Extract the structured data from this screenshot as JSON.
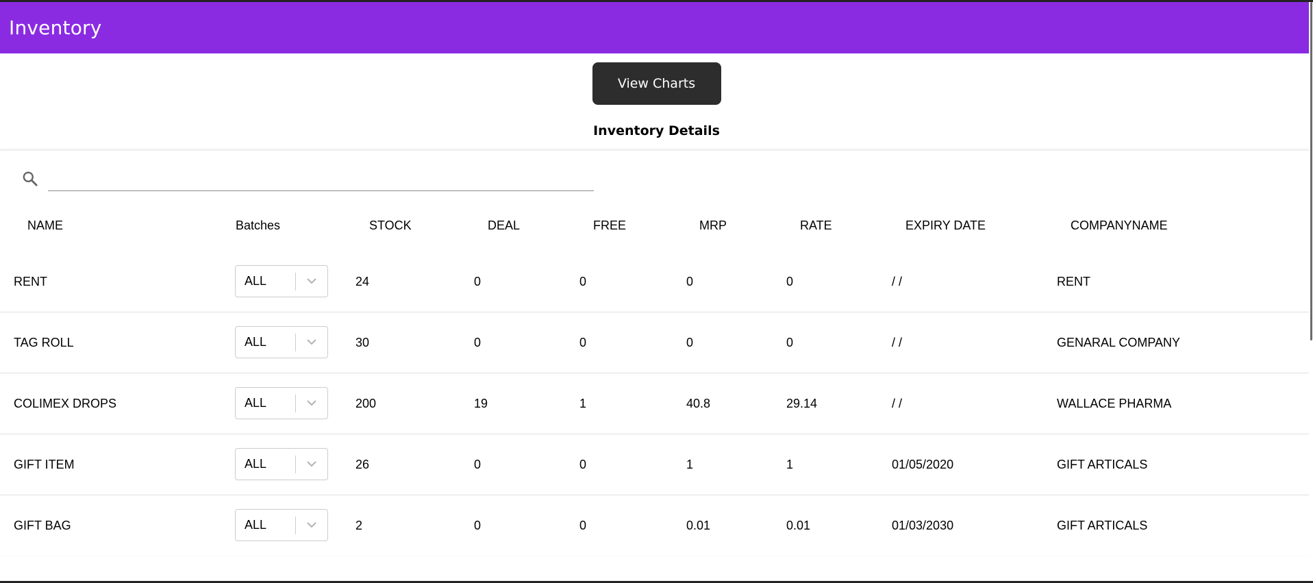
{
  "appbar": {
    "title": "Inventory"
  },
  "actions": {
    "view_charts_label": "View Charts"
  },
  "section": {
    "title": "Inventory Details"
  },
  "search": {
    "placeholder": "",
    "value": ""
  },
  "icons": {
    "search": "search-icon",
    "dropdown": "chevron-down-icon"
  },
  "colors": {
    "appbar": "#8a2be2",
    "button": "#2d2d2d"
  },
  "table": {
    "columns": [
      "NAME",
      "Batches",
      "STOCK",
      "DEAL",
      "FREE",
      "MRP",
      "RATE",
      "EXPIRY DATE",
      "COMPANYNAME"
    ],
    "rows": [
      {
        "name": "RENT",
        "batch": "ALL",
        "stock": "24",
        "deal": "0",
        "free": "0",
        "mrp": "0",
        "rate": "0",
        "expiry": "/ /",
        "company": "RENT"
      },
      {
        "name": "TAG ROLL",
        "batch": "ALL",
        "stock": "30",
        "deal": "0",
        "free": "0",
        "mrp": "0",
        "rate": "0",
        "expiry": "/ /",
        "company": "GENARAL COMPANY"
      },
      {
        "name": "COLIMEX DROPS",
        "batch": "ALL",
        "stock": "200",
        "deal": "19",
        "free": "1",
        "mrp": "40.8",
        "rate": "29.14",
        "expiry": "/ /",
        "company": "WALLACE PHARMA"
      },
      {
        "name": "GIFT ITEM",
        "batch": "ALL",
        "stock": "26",
        "deal": "0",
        "free": "0",
        "mrp": "1",
        "rate": "1",
        "expiry": "01/05/2020",
        "company": "GIFT ARTICALS"
      },
      {
        "name": "GIFT BAG",
        "batch": "ALL",
        "stock": "2",
        "deal": "0",
        "free": "0",
        "mrp": "0.01",
        "rate": "0.01",
        "expiry": "01/03/2030",
        "company": "GIFT ARTICALS"
      }
    ]
  }
}
